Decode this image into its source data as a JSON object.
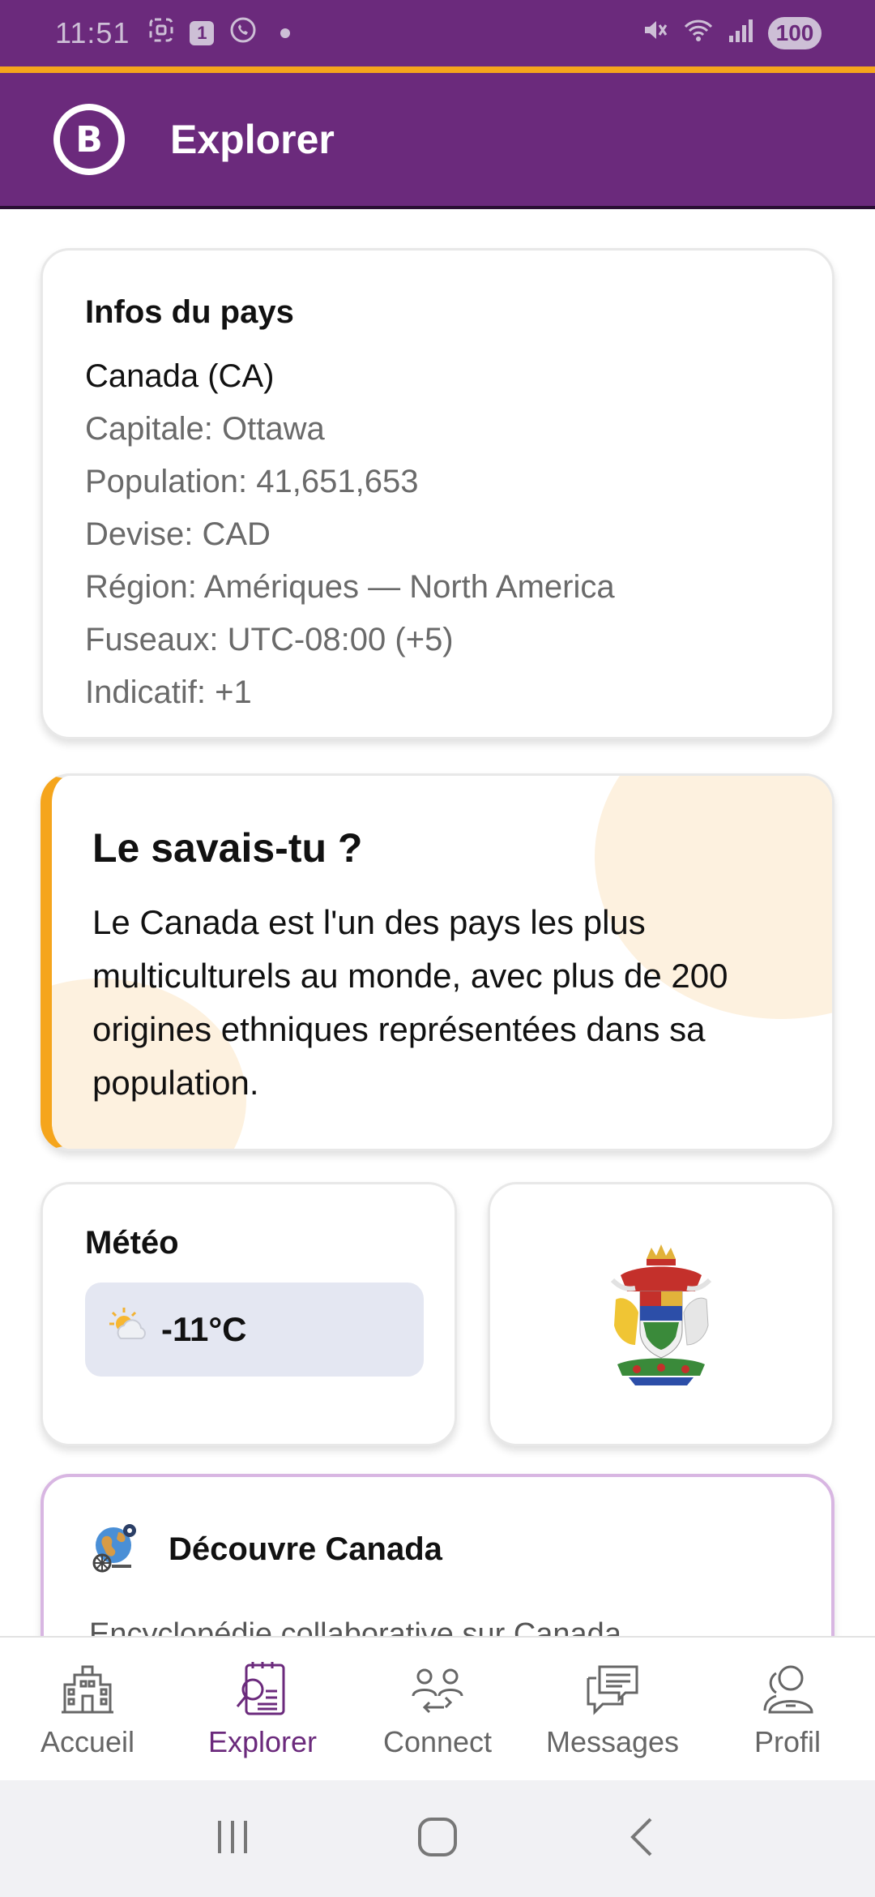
{
  "status_bar": {
    "time": "11:51",
    "notification_badge": "1",
    "battery": "100"
  },
  "app_bar": {
    "title": "Explorer",
    "logo_letter": "B"
  },
  "country_info": {
    "heading": "Infos du pays",
    "country": "Canada (CA)",
    "lines": [
      "Capitale: Ottawa",
      "Population: 41,651,653",
      "Devise: CAD",
      "Région: Amériques — North America",
      "Fuseaux: UTC-08:00 (+5)",
      "Indicatif: +1"
    ]
  },
  "fun_fact": {
    "title": "Le savais-tu ?",
    "text": "Le Canada est l'un des pays les plus multiculturels au monde, avec plus de 200 origines ethniques représentées dans sa population."
  },
  "weather": {
    "heading": "Météo",
    "icon": "partly-sunny-icon",
    "temperature": "-11°C"
  },
  "coat_of_arms": {
    "icon": "coat-of-arms-canada"
  },
  "discover": {
    "title": "Découvre Canada",
    "subtitle": "Encyclopédie collaborative sur Canada"
  },
  "bottom_nav": {
    "items": [
      {
        "label": "Accueil",
        "icon": "building-icon"
      },
      {
        "label": "Explorer",
        "icon": "explore-icon"
      },
      {
        "label": "Connect",
        "icon": "connect-icon"
      },
      {
        "label": "Messages",
        "icon": "chat-icon"
      },
      {
        "label": "Profil",
        "icon": "profile-icon"
      }
    ],
    "active_index": 1
  },
  "colors": {
    "brand_purple": "#6b2a7c",
    "accent_orange": "#f5a51c"
  }
}
